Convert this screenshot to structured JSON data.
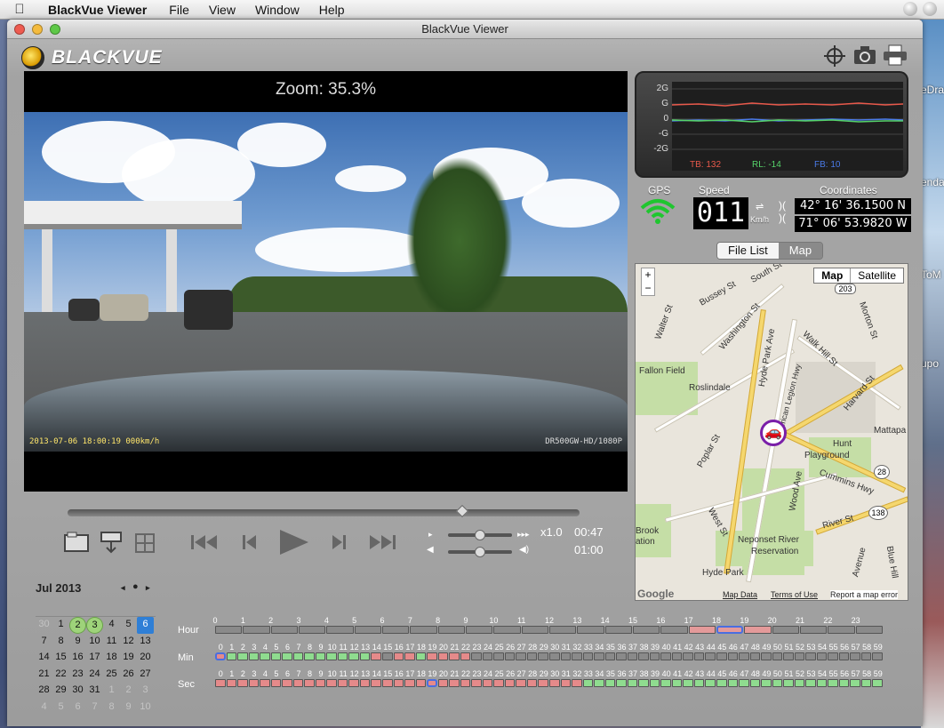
{
  "menubar": {
    "app_name": "BlackVue Viewer",
    "items": [
      "File",
      "View",
      "Window",
      "Help"
    ]
  },
  "window": {
    "title": "BlackVue Viewer"
  },
  "logo": {
    "text": "BLACKVUE"
  },
  "toolbar_icons": [
    "crosshair-icon",
    "camera-icon",
    "printer-icon"
  ],
  "video": {
    "zoom_label": "Zoom: 35.3%",
    "timestamp_overlay": "2013-07-06 18:00:19  000km/h",
    "model_overlay": "DR500GW-HD/1080P"
  },
  "gsensor": {
    "scale": [
      "2G",
      "G",
      "0",
      "-G",
      "-2G"
    ],
    "readings": [
      {
        "label": "TB: 132",
        "color": "#e8594b"
      },
      {
        "label": "RL: -14",
        "color": "#56d46a"
      },
      {
        "label": "FB: 10",
        "color": "#4a7ae8"
      }
    ]
  },
  "gps": {
    "gps_label": "GPS",
    "speed_label": "Speed",
    "speed_value": "011",
    "speed_unit": "Km/h",
    "coord_label": "Coordinates",
    "lat": "42° 16' 36.1500 N",
    "lon": "71° 06' 53.9820 W"
  },
  "tabs": {
    "file_list": "File List",
    "map": "Map"
  },
  "map": {
    "type_map": "Map",
    "type_satellite": "Satellite",
    "zoom_in": "+",
    "zoom_out": "−",
    "labels": {
      "bussey": "Bussey St",
      "south": "South St",
      "walter": "Walter St",
      "washington": "Washington St",
      "morton": "Morton St",
      "hydepark_ave": "Hyde Park Ave",
      "walkhill": "Walk Hill St",
      "fallon": "Fallon Field",
      "roslindale": "Roslindale",
      "harvard": "Harvard St",
      "legion": "American Legion Hwy",
      "mattapan": "Mattapa",
      "poplar": "Poplar St",
      "hunt": "Hunt",
      "playground": "Playground",
      "cummins": "Cummins Hwy",
      "wood": "Wood Ave",
      "west": "West St",
      "river": "River St",
      "brook": "Brook",
      "ation": "ation",
      "neponset": "Neponset River",
      "reservation": "Reservation",
      "hydepark": "Hyde Park",
      "avenue": "Avenue",
      "blue": "Blue Hill"
    },
    "routes": [
      "203",
      "28",
      "138"
    ],
    "footer": {
      "data": "Map Data",
      "terms": "Terms of Use",
      "report": "Report a map error",
      "google": "Google"
    }
  },
  "playback": {
    "progress": 0.77,
    "speed": "x1.0",
    "current_time": "00:47",
    "total_time": "01:00",
    "speed_slider": 0.5,
    "volume_slider": 0.5
  },
  "calendar": {
    "month": "Jul 2013",
    "weeks": [
      [
        {
          "d": "30",
          "m": "other"
        },
        {
          "d": "1",
          "m": "cur"
        },
        {
          "d": "2",
          "m": "rec"
        },
        {
          "d": "3",
          "m": "rec"
        },
        {
          "d": "4",
          "m": "cur"
        },
        {
          "d": "5",
          "m": "cur"
        },
        {
          "d": "6",
          "m": "sel"
        }
      ],
      [
        {
          "d": "7",
          "m": "cur"
        },
        {
          "d": "8",
          "m": "cur"
        },
        {
          "d": "9",
          "m": "cur"
        },
        {
          "d": "10",
          "m": "cur"
        },
        {
          "d": "11",
          "m": "cur"
        },
        {
          "d": "12",
          "m": "cur"
        },
        {
          "d": "13",
          "m": "cur"
        }
      ],
      [
        {
          "d": "14",
          "m": "cur"
        },
        {
          "d": "15",
          "m": "cur"
        },
        {
          "d": "16",
          "m": "cur"
        },
        {
          "d": "17",
          "m": "cur"
        },
        {
          "d": "18",
          "m": "cur"
        },
        {
          "d": "19",
          "m": "cur"
        },
        {
          "d": "20",
          "m": "cur"
        }
      ],
      [
        {
          "d": "21",
          "m": "cur"
        },
        {
          "d": "22",
          "m": "cur"
        },
        {
          "d": "23",
          "m": "cur"
        },
        {
          "d": "24",
          "m": "cur"
        },
        {
          "d": "25",
          "m": "cur"
        },
        {
          "d": "26",
          "m": "cur"
        },
        {
          "d": "27",
          "m": "cur"
        }
      ],
      [
        {
          "d": "28",
          "m": "cur"
        },
        {
          "d": "29",
          "m": "cur"
        },
        {
          "d": "30",
          "m": "cur"
        },
        {
          "d": "31",
          "m": "cur"
        },
        {
          "d": "1",
          "m": "other"
        },
        {
          "d": "2",
          "m": "other"
        },
        {
          "d": "3",
          "m": "other"
        }
      ],
      [
        {
          "d": "4",
          "m": "other"
        },
        {
          "d": "5",
          "m": "other"
        },
        {
          "d": "6",
          "m": "other"
        },
        {
          "d": "7",
          "m": "other"
        },
        {
          "d": "8",
          "m": "other"
        },
        {
          "d": "9",
          "m": "other"
        },
        {
          "d": "10",
          "m": "other"
        }
      ]
    ]
  },
  "timeline": {
    "hour_label": "Hour",
    "min_label": "Min",
    "sec_label": "Sec",
    "hours_recorded": [
      17,
      18,
      19
    ],
    "hour_selected": 18,
    "minutes_normal": [
      1,
      2,
      3,
      4,
      5,
      6,
      7,
      8,
      9,
      10,
      11,
      12,
      13,
      18
    ],
    "minutes_event": [
      14,
      16,
      17,
      19,
      20,
      21,
      22
    ],
    "minute_selected": 0,
    "seconds_split": 33,
    "second_selected": 19
  },
  "background": {
    "fragments": [
      "eDra",
      "enda",
      "ToM",
      "upo"
    ]
  }
}
